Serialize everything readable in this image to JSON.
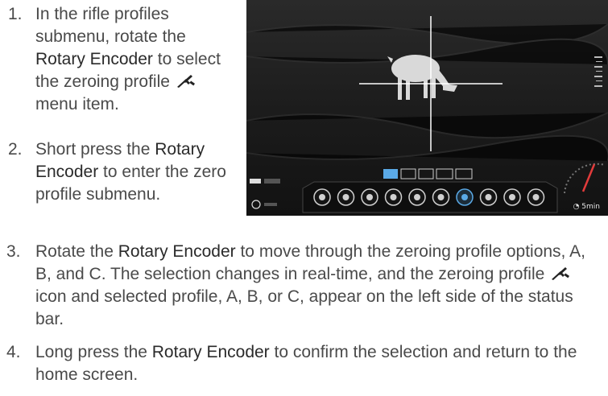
{
  "steps": [
    {
      "number": "1.",
      "parts": [
        "In the rifle profiles submenu, rotate the ",
        "Rotary Encoder",
        " to select the zeroing profile ",
        " menu item."
      ]
    },
    {
      "number": "2.",
      "parts": [
        "Short press the ",
        "Rotary Encoder",
        " to enter the zero profile submenu."
      ]
    },
    {
      "number": "3.",
      "parts": [
        "Rotate the ",
        "Rotary Encoder",
        " to move through the zeroing profile options, A, B, and C. The selection changes in real-time, and the zeroing profile ",
        " icon and selected profile, A, B, or C, appear on the left side of the status bar."
      ]
    },
    {
      "number": "4.",
      "parts": [
        "Long press the ",
        "Rotary Encoder",
        " to confirm the selection and return to the home screen."
      ]
    }
  ],
  "scope": {
    "timer_label": "5min",
    "menu_icons": [
      "wifi-icon",
      "compass-icon",
      "microphone-icon",
      "night-mode-icon",
      "camera-icon",
      "palette-icon",
      "zeroing-crosshair-icon",
      "reticle-icon",
      "gallery-icon",
      "settings-icon"
    ],
    "selected_menu_icon": "zeroing-crosshair-icon",
    "accent_color": "#5aa9e6",
    "compass_needle_color": "#e23b3b"
  },
  "icons": {
    "rifle": "rifle-icon"
  }
}
